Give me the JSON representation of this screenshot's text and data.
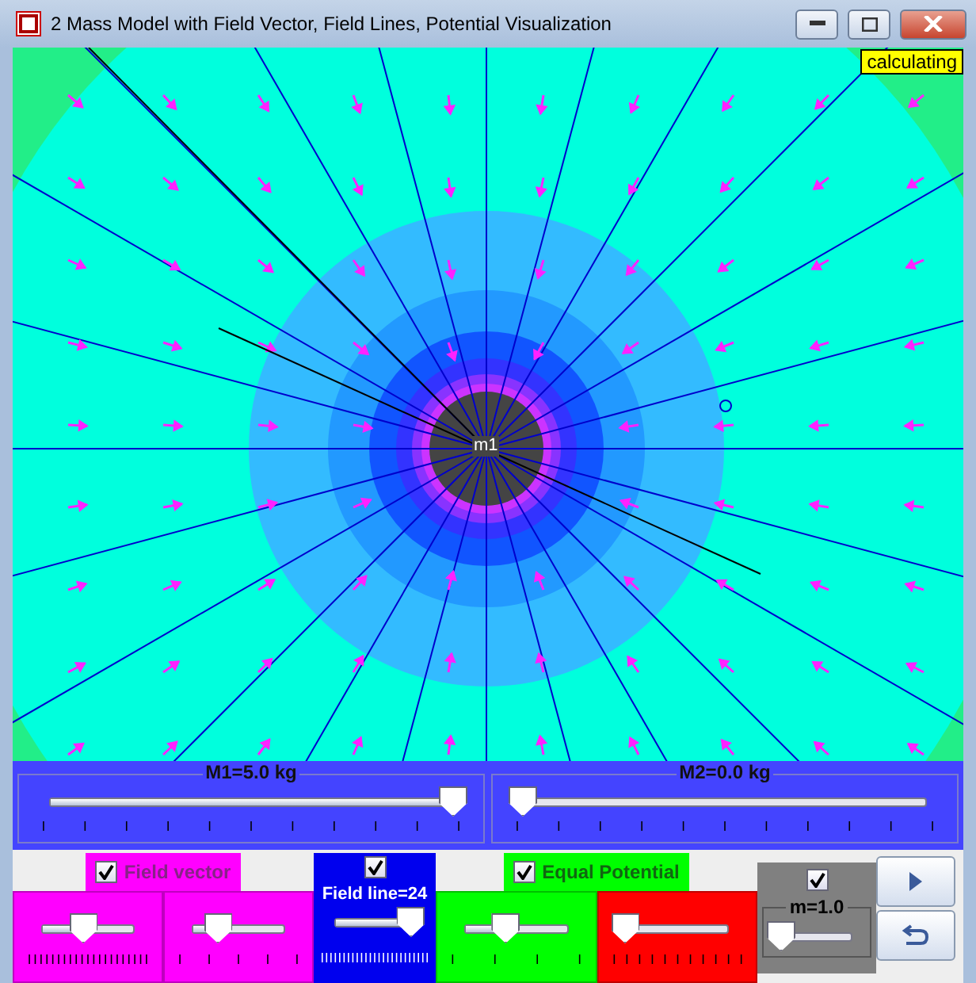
{
  "window": {
    "title": "2 Mass Model with Field Vector, Field Lines, Potential Visualization"
  },
  "canvas": {
    "status": "calculating",
    "mass_label": "m1"
  },
  "mass_sliders": [
    {
      "label": "M1=5.0 kg",
      "level": 1
    },
    {
      "label": "M2=0.0 kg",
      "level": 0
    }
  ],
  "field_vector": {
    "label": "Field vector",
    "checked": true,
    "sliders": [
      {
        "level": 0.45
      },
      {
        "level": 0.28
      }
    ]
  },
  "field_line": {
    "checked": true,
    "label": "Field line=24",
    "level": 0.95
  },
  "equal_potential": {
    "label": "Equal Potential",
    "checked": true,
    "sliders": [
      {
        "level": 0.4
      },
      {
        "level": 0
      }
    ]
  },
  "test_mass": {
    "checked": true,
    "label": "m=1.0",
    "level": 0
  }
}
